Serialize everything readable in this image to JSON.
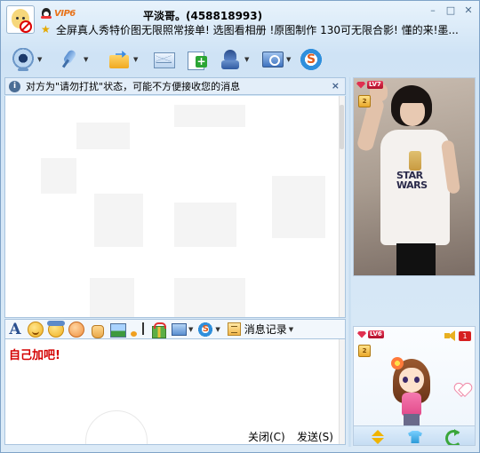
{
  "titlebar": {
    "vip_label": "VIP6",
    "title": "平淡哥。(458818993)",
    "status": "全屏真人秀特价图无限照常接单!    选图看相册 !原图制作 130可无限合影! 懂的来!墨..."
  },
  "window_controls": {
    "minimize": "–",
    "maximize": "□",
    "close": "✕"
  },
  "toolbar": {
    "items": [
      {
        "name": "video",
        "icon": "webcam-icon"
      },
      {
        "name": "voice",
        "icon": "microphone-icon"
      },
      {
        "name": "send-file",
        "icon": "folder-send-icon"
      },
      {
        "name": "mail",
        "icon": "mail-icon"
      },
      {
        "name": "create-group",
        "icon": "add-note-icon"
      },
      {
        "name": "apps",
        "icon": "user-group-icon"
      },
      {
        "name": "remote",
        "icon": "screen-icon"
      },
      {
        "name": "soso",
        "icon": "s-circle-icon"
      }
    ]
  },
  "notice": {
    "text": "对方为\"请勿打扰\"状态，可能不方便接收您的消息",
    "close": "×"
  },
  "format_bar": {
    "font_label": "A",
    "history_label": "消息记录"
  },
  "input": {
    "text": "自己加吧!"
  },
  "buttons": {
    "close_label": "关闭(C)",
    "send_label": "发送(S)"
  },
  "right_panel": {
    "photo_level": "LV7",
    "photo_print": [
      "STAR",
      "WARS"
    ],
    "show_level": "LV6",
    "show_count": "1"
  },
  "colors": {
    "accent": "#7fa3c8",
    "input_text": "#d40000",
    "background": "#dfeefa"
  }
}
